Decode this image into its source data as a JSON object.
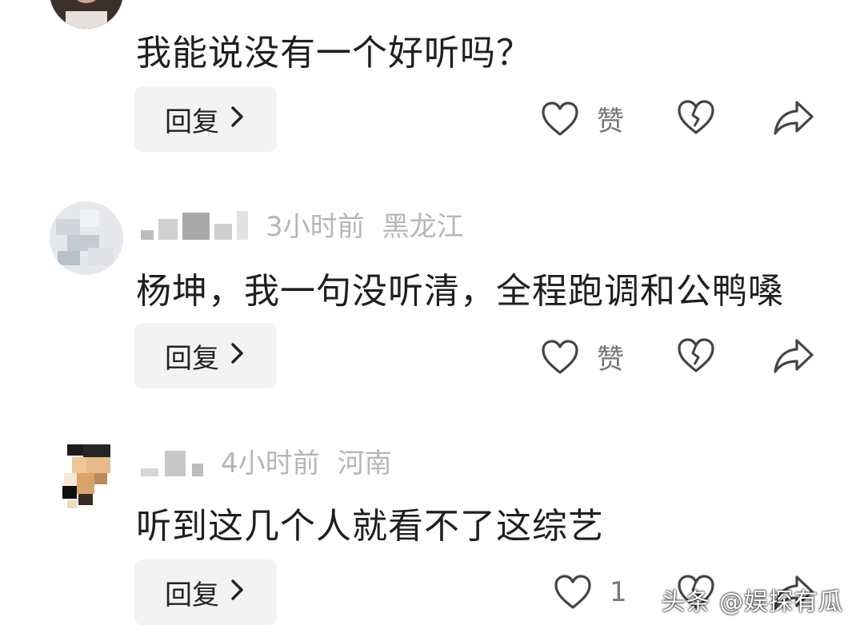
{
  "comments": [
    {
      "text": "我能说没有一个好听吗？",
      "reply_label": "回复",
      "like_label": "赞"
    },
    {
      "time": "3小时前",
      "location": "黑龙江",
      "text": "杨坤，我一句没听清，全程跑调和公鸭嗓",
      "reply_label": "回复",
      "like_label": "赞"
    },
    {
      "time": "4小时前",
      "location": "河南",
      "text": "听到这几个人就看不了这综艺",
      "reply_label": "回复",
      "like_label": "1"
    }
  ],
  "icons": {
    "reply_chevron": "chevron-right-icon",
    "like": "heart-icon",
    "dislike": "broken-heart-icon",
    "share": "share-arrow-icon"
  },
  "watermark": "头条 @娱探有瓜"
}
